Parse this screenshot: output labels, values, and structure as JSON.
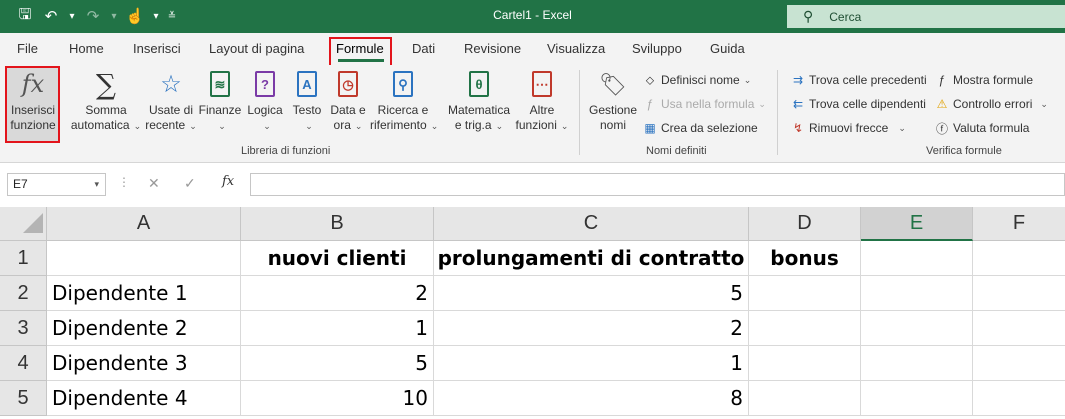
{
  "window": {
    "title": "Cartel1  -  Excel"
  },
  "search": {
    "label": "Cerca"
  },
  "tabs": [
    "File",
    "Home",
    "Inserisci",
    "Layout di pagina",
    "Formule",
    "Dati",
    "Revisione",
    "Visualizza",
    "Sviluppo",
    "Guida"
  ],
  "ribbon": {
    "insert_function": {
      "line1": "Inserisci",
      "line2": "funzione"
    },
    "autosum": {
      "line1": "Somma",
      "line2": "automatica"
    },
    "recent": {
      "line1": "Usate di",
      "line2": "recente"
    },
    "financial": {
      "line1": "Finanze",
      "line2": ""
    },
    "logical": {
      "line1": "Logica",
      "line2": ""
    },
    "text": {
      "line1": "Testo",
      "line2": ""
    },
    "datetime": {
      "line1": "Data e",
      "line2": "ora"
    },
    "lookup": {
      "line1": "Ricerca e",
      "line2": "riferimento"
    },
    "math": {
      "line1": "Matematica",
      "line2": "e trig.a"
    },
    "more": {
      "line1": "Altre",
      "line2": "funzioni"
    },
    "library_label": "Libreria di funzioni",
    "name_manager": {
      "line1": "Gestione",
      "line2": "nomi"
    },
    "define_name": "Definisci nome",
    "use_in_formula": "Usa nella formula",
    "create_from_selection": "Crea da selezione",
    "names_label": "Nomi definiti",
    "trace_precedents": "Trova celle precedenti",
    "trace_dependents": "Trova celle dipendenti",
    "remove_arrows": "Rimuovi frecce",
    "show_formulas": "Mostra formule",
    "error_checking": "Controllo errori",
    "evaluate_formula": "Valuta formula",
    "audit_label": "Verifica formule"
  },
  "formula_bar": {
    "name_box": "E7",
    "fx": "fx",
    "value": ""
  },
  "columns": [
    "A",
    "B",
    "C",
    "D",
    "E",
    "F"
  ],
  "rows": [
    "1",
    "2",
    "3",
    "4",
    "5"
  ],
  "cells": [
    [
      "",
      "nuovi clienti",
      "prolungamenti di contratto",
      "bonus",
      "",
      ""
    ],
    [
      "Dipendente 1",
      "2",
      "5",
      "",
      "",
      ""
    ],
    [
      "Dipendente 2",
      "1",
      "2",
      "",
      "",
      ""
    ],
    [
      "Dipendente 3",
      "5",
      "1",
      "",
      "",
      ""
    ],
    [
      "Dipendente 4",
      "10",
      "8",
      "",
      "",
      ""
    ]
  ]
}
